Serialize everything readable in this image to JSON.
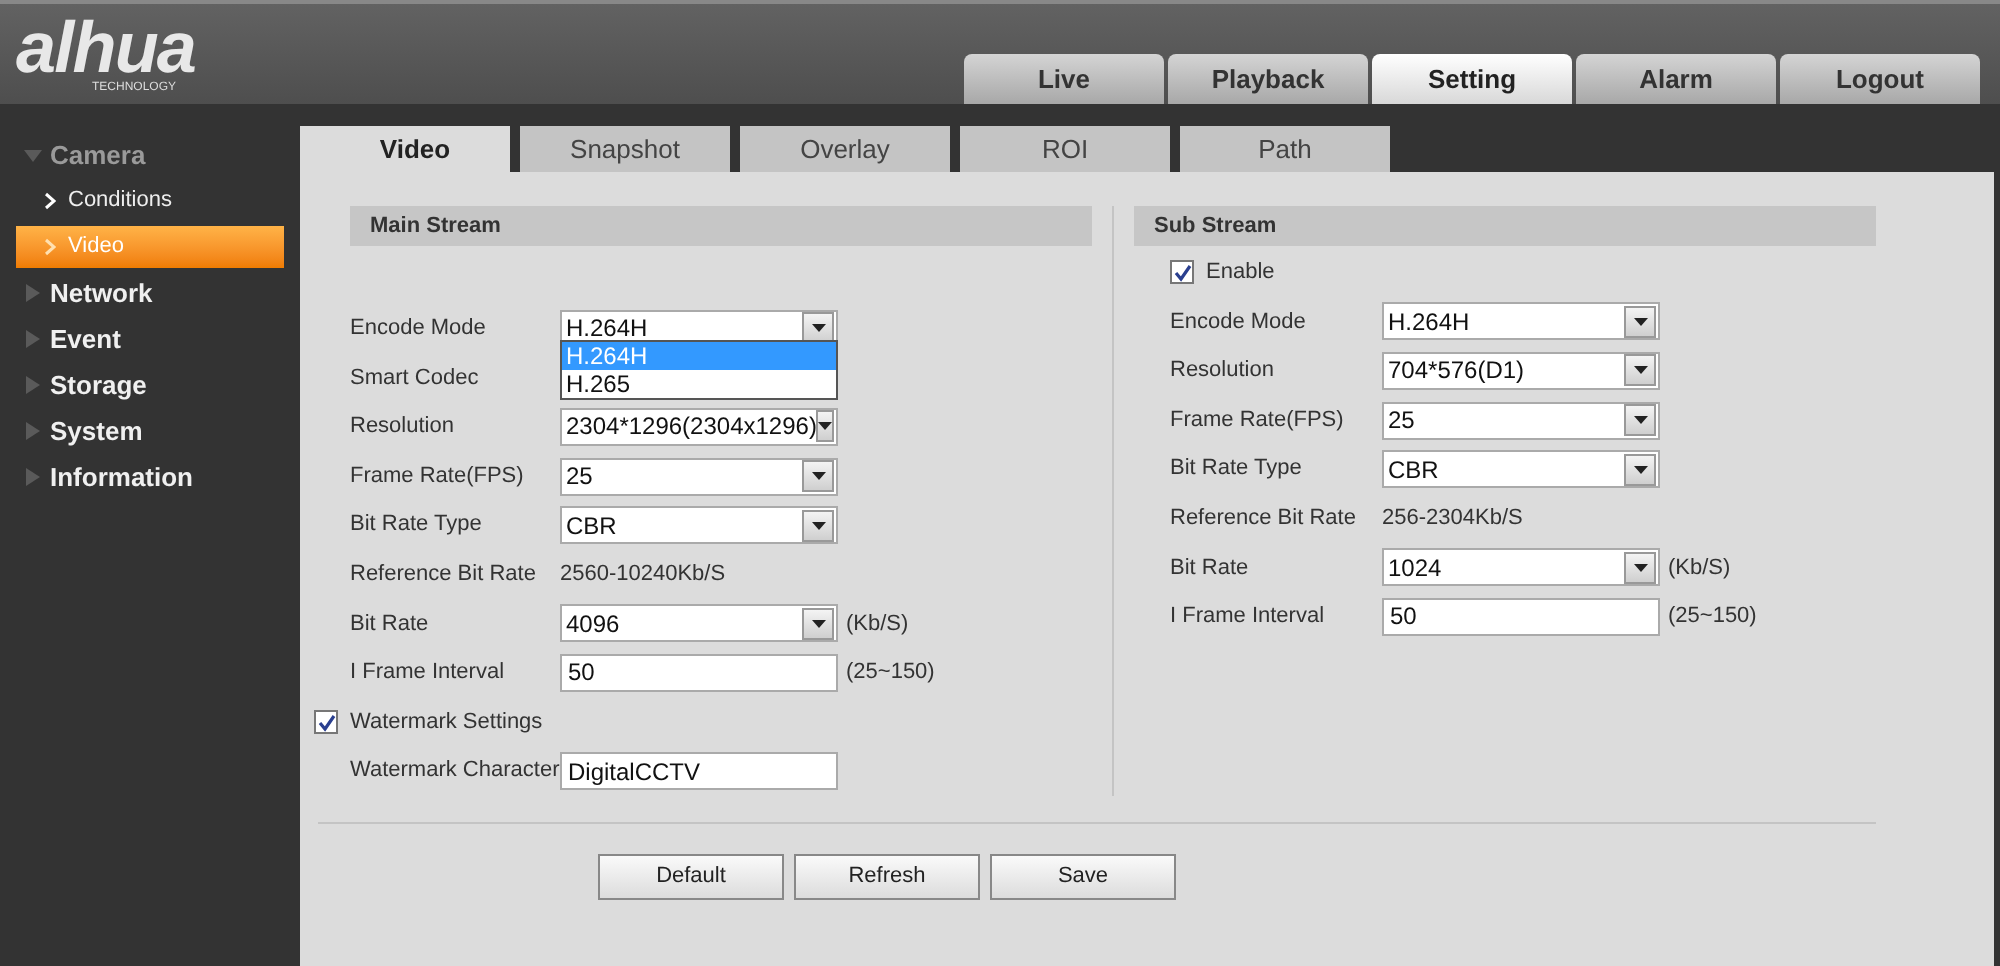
{
  "logo": {
    "brand": "alhua",
    "tagline": "TECHNOLOGY"
  },
  "nav_tabs": [
    {
      "label": "Live",
      "selected": false
    },
    {
      "label": "Playback",
      "selected": false
    },
    {
      "label": "Setting",
      "selected": true
    },
    {
      "label": "Alarm",
      "selected": false
    },
    {
      "label": "Logout",
      "selected": false
    }
  ],
  "sidebar": {
    "items": [
      {
        "label": "Camera",
        "expanded": true,
        "children": [
          {
            "label": "Conditions",
            "selected": false
          },
          {
            "label": "Video",
            "selected": true
          }
        ]
      },
      {
        "label": "Network",
        "expanded": false
      },
      {
        "label": "Event",
        "expanded": false
      },
      {
        "label": "Storage",
        "expanded": false
      },
      {
        "label": "System",
        "expanded": false
      },
      {
        "label": "Information",
        "expanded": false
      }
    ]
  },
  "tabs": [
    {
      "label": "Video",
      "selected": true
    },
    {
      "label": "Snapshot",
      "selected": false
    },
    {
      "label": "Overlay",
      "selected": false
    },
    {
      "label": "ROI",
      "selected": false
    },
    {
      "label": "Path",
      "selected": false
    }
  ],
  "main_stream": {
    "title": "Main Stream",
    "fields": [
      {
        "kind": "select",
        "label": "Encode Mode",
        "value": "H.264H",
        "expanded": true,
        "options": [
          {
            "label": "H.264H",
            "selected": true
          },
          {
            "label": "H.265",
            "selected": false
          }
        ]
      },
      {
        "kind": "covered",
        "label": "Smart Codec"
      },
      {
        "kind": "select",
        "label": "Resolution",
        "value": "2304*1296(2304x1296)"
      },
      {
        "kind": "select",
        "label": "Frame Rate(FPS)",
        "value": "25"
      },
      {
        "kind": "select",
        "label": "Bit Rate Type",
        "value": "CBR"
      },
      {
        "kind": "text",
        "label": "Reference Bit Rate",
        "value": "2560-10240Kb/S"
      },
      {
        "kind": "select",
        "label": "Bit Rate",
        "value": "4096",
        "unit": "(Kb/S)"
      },
      {
        "kind": "input",
        "label": "I Frame Interval",
        "value": "50",
        "unit": "(25~150)"
      },
      {
        "kind": "checkbox",
        "label": "Watermark Settings",
        "checked": true
      },
      {
        "kind": "input",
        "label": "Watermark Character",
        "value": "DigitalCCTV"
      }
    ]
  },
  "sub_stream": {
    "title": "Sub Stream",
    "fields": [
      {
        "kind": "checkbox",
        "label": "Enable",
        "checked": true
      },
      {
        "kind": "select",
        "label": "Encode Mode",
        "value": "H.264H"
      },
      {
        "kind": "select",
        "label": "Resolution",
        "value": "704*576(D1)"
      },
      {
        "kind": "select",
        "label": "Frame Rate(FPS)",
        "value": "25"
      },
      {
        "kind": "select",
        "label": "Bit Rate Type",
        "value": "CBR"
      },
      {
        "kind": "text",
        "label": "Reference Bit Rate",
        "value": "256-2304Kb/S"
      },
      {
        "kind": "select",
        "label": "Bit Rate",
        "value": "1024",
        "unit": "(Kb/S)"
      },
      {
        "kind": "input",
        "label": "I Frame Interval",
        "value": "50",
        "unit": "(25~150)"
      }
    ]
  },
  "buttons": [
    "Default",
    "Refresh",
    "Save"
  ]
}
